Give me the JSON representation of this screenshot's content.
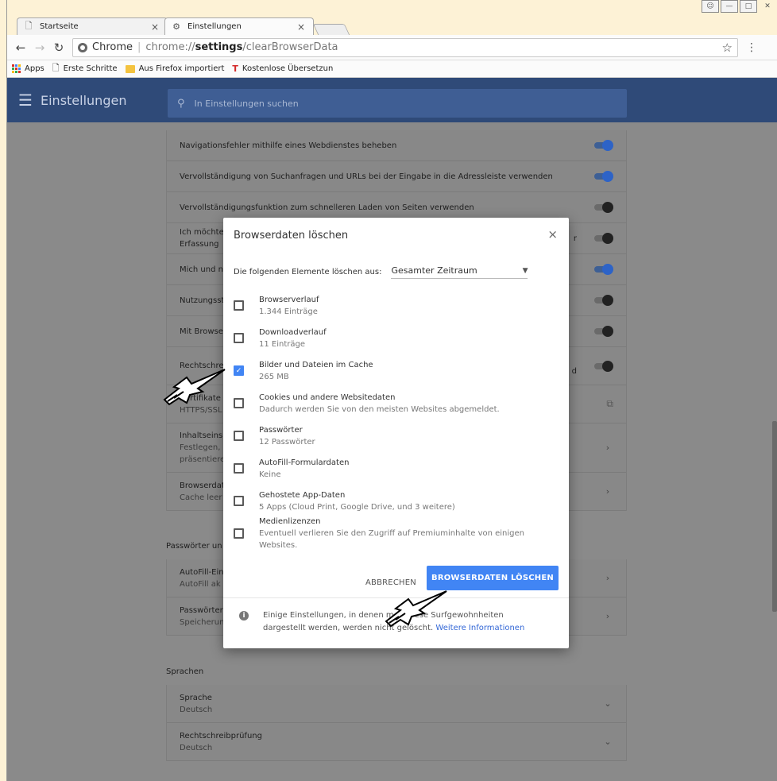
{
  "browser": {
    "tabs": [
      {
        "label": "Startseite",
        "icon": "page-icon"
      },
      {
        "label": "Einstellungen",
        "icon": "gear-icon"
      }
    ],
    "omnibox": {
      "site_label": "Chrome",
      "url_scheme": "chrome://",
      "url_host": "settings",
      "url_path": "/clearBrowserData"
    },
    "bookmarks": [
      {
        "label": "Apps",
        "icon": "apps-icon"
      },
      {
        "label": "Erste Schritte",
        "icon": "page-icon"
      },
      {
        "label": "Aus Firefox importiert",
        "icon": "folder-icon"
      },
      {
        "label": "Kostenlose Übersetzun",
        "icon": "translate-icon"
      }
    ]
  },
  "settings": {
    "header_title": "Einstellungen",
    "search_placeholder": "In Einstellungen suchen",
    "rows": [
      {
        "text": "Navigationsfehler mithilfe eines Webdienstes beheben",
        "toggle": "on"
      },
      {
        "text": "Vervollständigung von Suchanfragen und URLs bei der Eingabe in die Adressleiste verwenden",
        "toggle": "on"
      },
      {
        "text": "Vervollständigungsfunktion zum schnelleren Laden von Seiten verwenden",
        "toggle": "off"
      },
      {
        "text": "Ich möchte",
        "sub": "Erfassung",
        "tail": "r",
        "toggle": "off"
      },
      {
        "text": "Mich und n",
        "toggle": "on"
      },
      {
        "text": "Nutzungsst",
        "toggle": "off"
      },
      {
        "text": "Mit Browse",
        "toggle": "off"
      },
      {
        "text": "Rechtschre",
        "tail": "d",
        "toggle": "off"
      },
      {
        "text": "Zertifikate",
        "sub": "HTTPS/SSL",
        "control": "external"
      },
      {
        "text": "Inhaltseins",
        "sub": "Festlegen,",
        "sub2": "präsentiere",
        "control": "chevron"
      },
      {
        "text": "Browserdat",
        "sub": "Cache leer",
        "control": "chevron"
      }
    ],
    "section_passwords": "Passwörter un",
    "password_rows": [
      {
        "text": "AutoFill-Ein",
        "sub": "AutoFill ak",
        "control": "chevron"
      },
      {
        "text": "Passwörter",
        "sub": "Speicherun",
        "control": "chevron"
      }
    ],
    "section_languages": "Sprachen",
    "language_rows": [
      {
        "text": "Sprache",
        "sub": "Deutsch"
      },
      {
        "text": "Rechtschreibprüfung",
        "sub": "Deutsch"
      }
    ]
  },
  "dialog": {
    "title": "Browserdaten löschen",
    "range_label": "Die folgenden Elemente löschen aus:",
    "range_value": "Gesamter Zeitraum",
    "items": [
      {
        "label": "Browserverlauf",
        "sub": "1.344 Einträge",
        "checked": false
      },
      {
        "label": "Downloadverlauf",
        "sub": "11 Einträge",
        "checked": false
      },
      {
        "label": "Bilder und Dateien im Cache",
        "sub": "265 MB",
        "checked": true
      },
      {
        "label": "Cookies und andere Websitedaten",
        "sub": "Dadurch werden Sie von den meisten Websites abgemeldet.",
        "checked": false
      },
      {
        "label": "Passwörter",
        "sub": "12 Passwörter",
        "checked": false
      },
      {
        "label": "AutoFill-Formulardaten",
        "sub": "Keine",
        "checked": false
      },
      {
        "label": "Gehostete App-Daten",
        "sub": "5 Apps (Cloud Print, Google Drive, und 3 weitere)",
        "checked": false
      },
      {
        "label": "Medienlizenzen",
        "sub": "Eventuell verlieren Sie den Zugriff auf Premiuminhalte von einigen Websites.",
        "checked": false
      }
    ],
    "cancel_label": "ABBRECHEN",
    "confirm_label": "BROWSERDATEN LÖSCHEN",
    "footer_text_1": "Einige Einstellungen, in denen m",
    "footer_text_2": "ese Surfgewohnheiten",
    "footer_text_3": "dargestellt werden, werden nicht gelöscht.",
    "footer_link": "Weitere Informationen"
  },
  "colors": {
    "accent": "#4185f4",
    "header": "#2f4a78"
  }
}
